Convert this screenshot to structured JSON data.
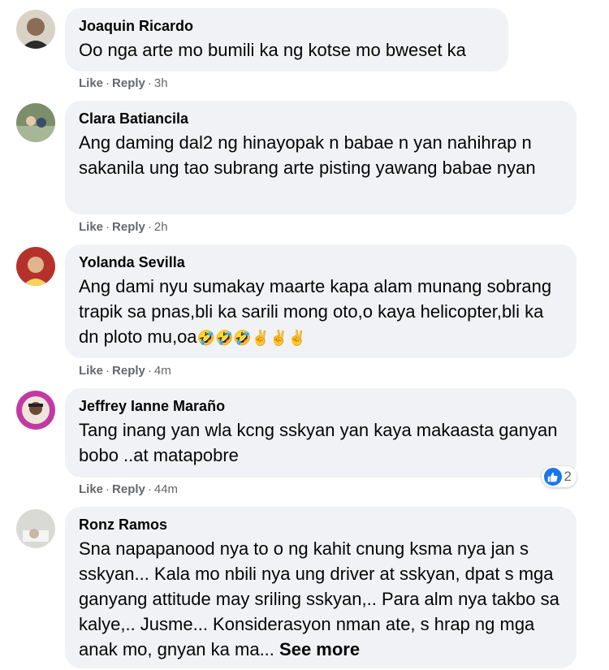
{
  "comments": [
    {
      "author": "Joaquin Ricardo",
      "text": "Oo nga arte mo bumili ka ng kotse mo bweset ka",
      "like": "Like",
      "reply": "Reply",
      "time": "3h"
    },
    {
      "author": "Clara Batiancila",
      "text": "Ang daming dal2 ng hinayopak n babae n yan nahihrap n sakanila ung tao subrang arte pisting yawang babae nyan",
      "like": "Like",
      "reply": "Reply",
      "time": "2h"
    },
    {
      "author": "Yolanda Sevilla",
      "text": "Ang dami nyu sumakay maarte kapa alam munang sobrang trapik sa pnas,bli ka sarili mong oto,o kaya helicopter,bli ka dn ploto mu,oa",
      "emojis": "🤣🤣🤣✌️✌️✌️",
      "like": "Like",
      "reply": "Reply",
      "time": "4m"
    },
    {
      "author": "Jeffrey Ianne Maraño",
      "text": "Tang inang yan wla kcng sskyan yan kaya makaasta ganyan bobo ..at matapobre",
      "reaction_count": "2",
      "reaction_icon": "like-icon",
      "like": "Like",
      "reply": "Reply",
      "time": "44m"
    },
    {
      "author": "Ronz Ramos",
      "text": "Sna napapanood nya to o ng kahit cnung ksma nya jan s sskyan... Kala mo nbili nya ung driver at sskyan, dpat s mga ganyang attitude may sriling sskyan,.. Para alm nya takbo sa kalye,.. Jusme... Konsiderasyon nman ate, s hrap ng mga anak mo, gnyan ka ma...",
      "see_more": "See more"
    }
  ]
}
